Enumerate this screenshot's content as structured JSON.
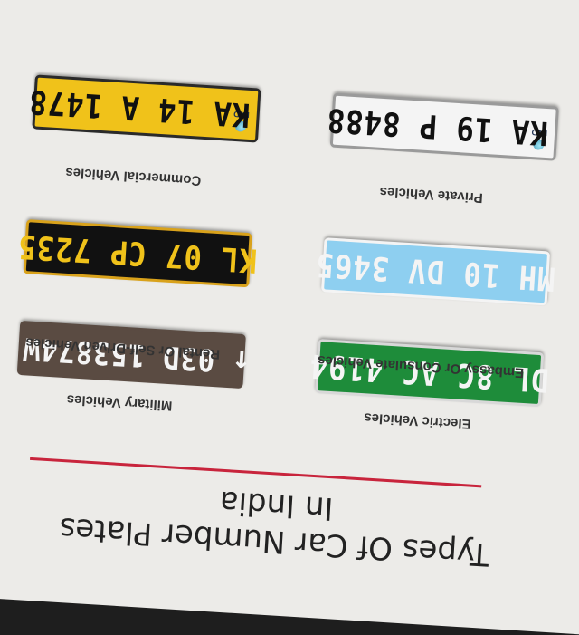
{
  "title": {
    "line1": "Types Of Car Number Plates",
    "line2": "In India"
  },
  "plates": {
    "private": {
      "number": "KA 19 P 8488",
      "caption": "Private Vehicles",
      "badge": "IND"
    },
    "commercial": {
      "number": "KA 14 A 1478",
      "caption": "Commercial Vehicles",
      "badge": "IND"
    },
    "rental": {
      "number": "KL 07 CP 7235",
      "caption": "Rental Or Self-Driven Vehicles"
    },
    "embassy": {
      "number": "MH 10 DV 3465",
      "caption": "Embassy Or Consulate Vehicles"
    },
    "electric": {
      "number": "DL 8C AC 4194",
      "caption": "Electric Vehicles"
    },
    "military": {
      "number": "03D 153874W",
      "arrow": "↑",
      "caption": "Military Vehicles"
    }
  },
  "colors": {
    "accent_rule": "#c8243c",
    "page_background": "#ecebe8",
    "commercial_yellow": "#f0c21a",
    "electric_green": "#1e8c3a",
    "embassy_blue": "#8ecff0"
  }
}
